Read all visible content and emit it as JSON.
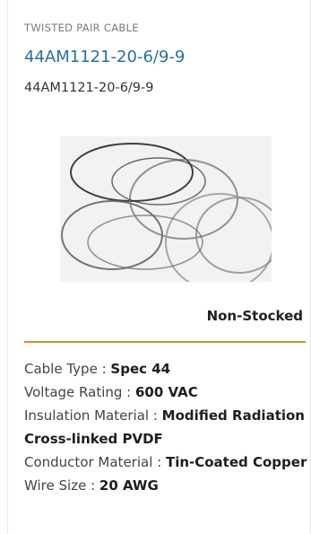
{
  "product": {
    "category": "TWISTED PAIR CABLE",
    "title": "44AM1121-20-6/9-9",
    "part_number": "44AM1121-20-6/9-9",
    "stock_status": "Non-Stocked"
  },
  "colors": {
    "link": "#2a6f9a",
    "accent_divider": "#e08a22"
  },
  "specs": [
    {
      "label": "Cable Type",
      "value": "Spec 44"
    },
    {
      "label": "Voltage Rating",
      "value": "600 VAC"
    },
    {
      "label": "Insulation Material",
      "value": "Modified Radiation Cross-linked PVDF"
    },
    {
      "label": "Conductor Material",
      "value": "Tin-Coated Copper"
    },
    {
      "label": "Wire Size",
      "value": "20 AWG"
    }
  ]
}
